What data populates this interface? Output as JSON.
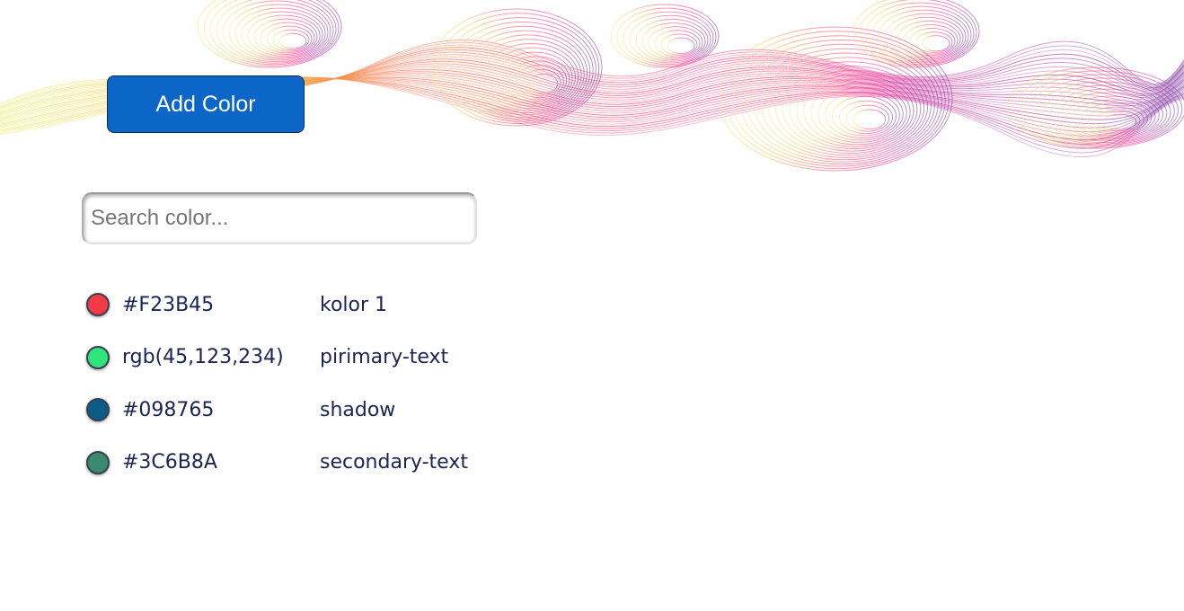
{
  "toolbar": {
    "add_color_label": "Add Color"
  },
  "search": {
    "placeholder": "Search color...",
    "value": ""
  },
  "colors": [
    {
      "code": "#F23B45",
      "name": "kolor 1",
      "swatch": "#F23B45"
    },
    {
      "code": "rgb(45,123,234)",
      "name": "pirimary-text",
      "swatch": "#2DE57A"
    },
    {
      "code": "#098765",
      "name": "shadow",
      "swatch": "#0B5C86"
    },
    {
      "code": "#3C6B8A",
      "name": "secondary-text",
      "swatch": "#3A8A6E"
    }
  ],
  "banner": {
    "gradient_colors": [
      "#E9F07A",
      "#F7C044",
      "#F2545B",
      "#EE2F92",
      "#A63FA8",
      "#7E3AA0"
    ]
  }
}
